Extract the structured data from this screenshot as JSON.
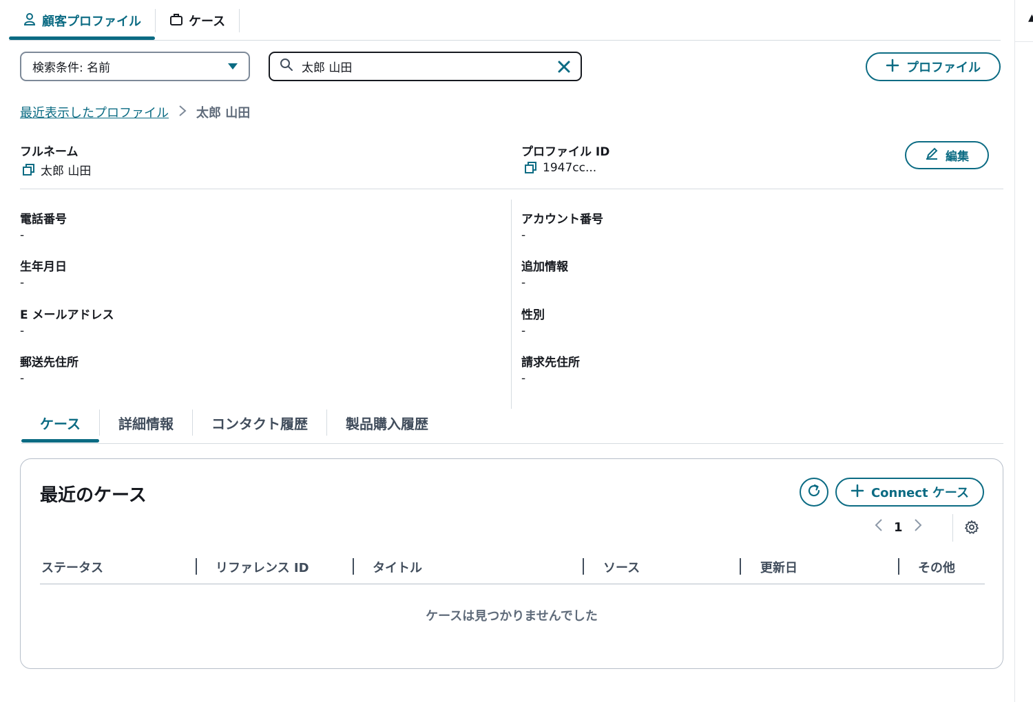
{
  "top_tabs": [
    {
      "label": "顧客プロファイル",
      "icon": "user-icon",
      "active": true
    },
    {
      "label": "ケース",
      "icon": "briefcase-icon",
      "active": false
    }
  ],
  "search": {
    "filter_label": "検索条件: 名前",
    "query": "太郎 山田"
  },
  "add_profile_label": "プロファイル",
  "breadcrumb": {
    "parent": "最近表示したプロファイル",
    "current": "太郎 山田"
  },
  "profile": {
    "full_name_label": "フルネーム",
    "full_name": "太郎 山田",
    "profile_id_label": "プロファイル ID",
    "profile_id": "1947cc...",
    "edit_label": "編集"
  },
  "fields": {
    "phone": {
      "label": "電話番号",
      "value": "-"
    },
    "birthdate": {
      "label": "生年月日",
      "value": "-"
    },
    "email": {
      "label": "E メールアドレス",
      "value": "-"
    },
    "mailing_address": {
      "label": "郵送先住所",
      "value": "-"
    },
    "account_number": {
      "label": "アカウント番号",
      "value": "-"
    },
    "additional_info": {
      "label": "追加情報",
      "value": "-"
    },
    "gender": {
      "label": "性別",
      "value": "-"
    },
    "billing_address": {
      "label": "請求先住所",
      "value": "-"
    }
  },
  "section_tabs": [
    {
      "label": "ケース",
      "active": true
    },
    {
      "label": "詳細情報",
      "active": false
    },
    {
      "label": "コンタクト履歴",
      "active": false
    },
    {
      "label": "製品購入履歴",
      "active": false
    }
  ],
  "cases": {
    "title": "最近のケース",
    "connect_label": "Connect ケース",
    "page": "1",
    "columns": [
      "ステータス",
      "リファレンス ID",
      "タイトル",
      "ソース",
      "更新日",
      "その他"
    ],
    "empty_message": "ケースは見つかりませんでした"
  },
  "colors": {
    "accent": "#0b6b83",
    "border": "#7d8998",
    "text": "#16191f",
    "muted": "#5f6b7a"
  }
}
